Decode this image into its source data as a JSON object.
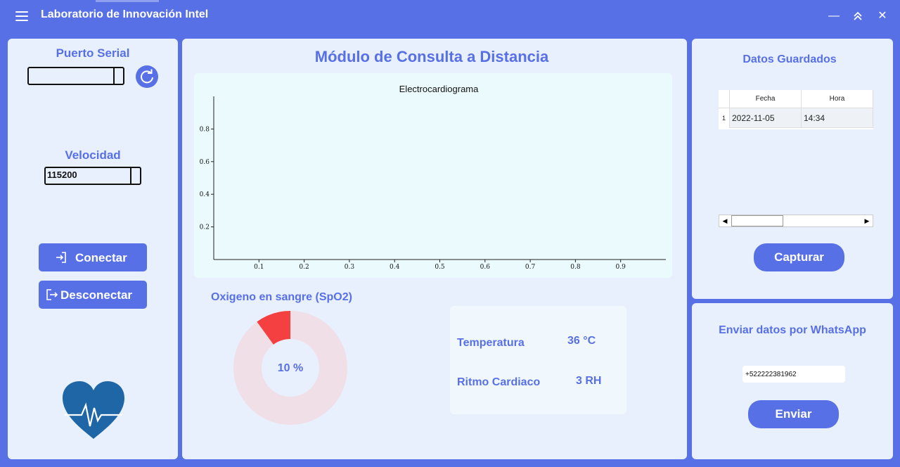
{
  "window": {
    "title": "Laboratorio de Innovación Intel"
  },
  "left": {
    "puerto_label": "Puerto Serial",
    "puerto_value": "",
    "velocidad_label": "Velocidad",
    "velocidad_value": "115200",
    "conectar_label": "Conectar",
    "desconectar_label": "Desconectar"
  },
  "center": {
    "title": "Módulo de Consulta a Distancia",
    "spo2_label": "Oxigeno en sangre (SpO2)",
    "spo2_value_text": "10 %",
    "spo2_fraction": 0.1,
    "temp_label": "Temperatura",
    "temp_value": "36 °C",
    "ritmo_label": "Ritmo Cardiaco",
    "ritmo_value": "3 RH"
  },
  "chart_data": {
    "type": "line",
    "title": "Electrocardiograma",
    "xlabel": "",
    "ylabel": "",
    "xlim": [
      0,
      1
    ],
    "ylim": [
      0,
      1
    ],
    "xticks": [
      "0.1",
      "0.2",
      "0.3",
      "0.4",
      "0.5",
      "0.6",
      "0.7",
      "0.8",
      "0.9"
    ],
    "yticks": [
      "0.2",
      "0.4",
      "0.6",
      "0.8"
    ],
    "series": []
  },
  "right": {
    "datos_title": "Datos Guardados",
    "table": {
      "columns": [
        "Fecha",
        "Hora"
      ],
      "rows": [
        {
          "index": "1",
          "fecha": "2022-11-05",
          "hora": "14:34"
        }
      ]
    },
    "capturar_label": "Capturar",
    "whatsapp_title": "Enviar datos por WhatsApp",
    "phone_value": "+522222381962",
    "enviar_label": "Enviar"
  },
  "colors": {
    "accent": "#5870e6",
    "panel": "#e8effd",
    "spo2_fill": "#f44040",
    "spo2_track": "#f1dfe7"
  }
}
